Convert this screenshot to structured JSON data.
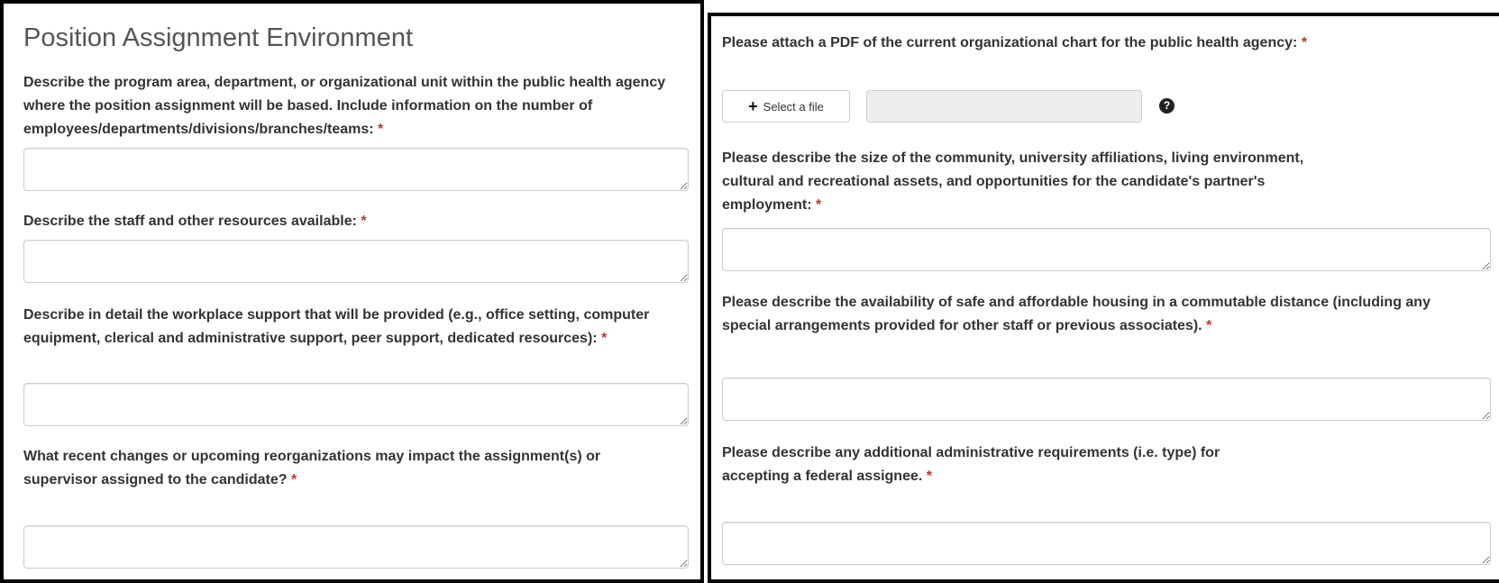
{
  "left": {
    "title": "Position Assignment Environment",
    "questions": [
      {
        "text": "Describe the program area, department, or organizational unit within the public health agency where the position assignment will be based. Include information on the number of employees/departments/divisions/branches/teams:",
        "required": "*",
        "value": ""
      },
      {
        "text": "Describe the staff and other resources available:",
        "required": "*",
        "value": ""
      },
      {
        "text": "Describe in detail the workplace support that will be provided (e.g., office setting, computer equipment, clerical and administrative support, peer support, dedicated resources):",
        "required": "*",
        "value": ""
      },
      {
        "text": "What recent changes or upcoming reorganizations may impact the assignment(s) or supervisor assigned to the candidate?",
        "required": "*",
        "value": ""
      }
    ]
  },
  "right": {
    "attach": {
      "text": "Please attach a PDF of the current organizational chart for the public health agency:",
      "required": "*",
      "button_label": "Select a file",
      "button_icon": "plus-icon",
      "help_icon": "question-circle-icon",
      "help_glyph": "?",
      "file_value": ""
    },
    "questions": [
      {
        "text": "Please describe the size of the community, university affiliations, living environment, cultural and recreational assets, and opportunities for the candidate's partner's employment:",
        "required": "*",
        "value": ""
      },
      {
        "text": "Please describe the availability of safe and affordable housing in a commutable distance (including any special arrangements provided for other staff or previous associates).",
        "required": "*",
        "value": ""
      },
      {
        "text": "Please describe any additional administrative requirements (i.e. type) for accepting a federal assignee.",
        "required": "*",
        "value": ""
      }
    ]
  },
  "colors": {
    "required": "#c9302c",
    "label": "#333333",
    "heading": "#555555",
    "border": "#cccccc"
  }
}
